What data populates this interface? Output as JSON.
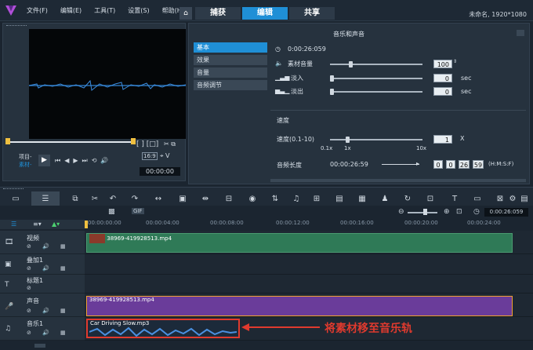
{
  "menu": [
    "文件(F)",
    "编辑(E)",
    "工具(T)",
    "设置(S)",
    "帮助(H)"
  ],
  "tabs": {
    "capture": "捕获",
    "edit": "编辑",
    "share": "共享"
  },
  "project_info": "未命名, 1920*1080",
  "preview": {
    "mode_project": "项目-",
    "mode_clip": "素材-",
    "timecode": "00:00:00",
    "ratio": "16:9"
  },
  "options": {
    "title": "音乐和声音",
    "sidebar": [
      "基本",
      "效果",
      "音量",
      "音频调节"
    ],
    "duration": "0:00:26:059",
    "clip_volume_label": "素材音量",
    "clip_volume": "100",
    "fade_in_label": "淡入",
    "fade_in": "0",
    "fade_out_label": "淡出",
    "fade_out": "0",
    "sec": "sec",
    "speed_section": "速度",
    "speed_label": "速度(0.1-10)",
    "speed_value": "1",
    "speed_unit": "X",
    "speed_min": "0.1x",
    "speed_mid": "1x",
    "speed_max": "10x",
    "length_label": "音频长度",
    "length_value": "00:00:26:59",
    "length_h": "0",
    "length_m": "0",
    "length_s": "26",
    "length_f": "59",
    "length_format": "(H:M:S:F)"
  },
  "timeline": {
    "zoom_timecode": "0:00:26:059",
    "ruler": [
      "00:00:00:00",
      "00:00:04:00",
      "00:00:08:00",
      "00:00:12:00",
      "00:00:16:00",
      "00:00:20:00",
      "00:00:24:00"
    ],
    "tracks": [
      {
        "name": "视频",
        "clip": "38969-419928513.mp4"
      },
      {
        "name": "叠加1",
        "clip": ""
      },
      {
        "name": "标题1",
        "clip": ""
      },
      {
        "name": "声音",
        "clip": "38969-419928513.mp4"
      },
      {
        "name": "音乐1",
        "clip": "Car Driving Slow.mp3"
      }
    ]
  },
  "annotation": "将素材移至音乐轨",
  "colors": {
    "accent": "#1f8fd6",
    "video_clip": "#2f7a57",
    "audio_clip": "#6a3c9a",
    "annotation": "#e03a2e"
  }
}
